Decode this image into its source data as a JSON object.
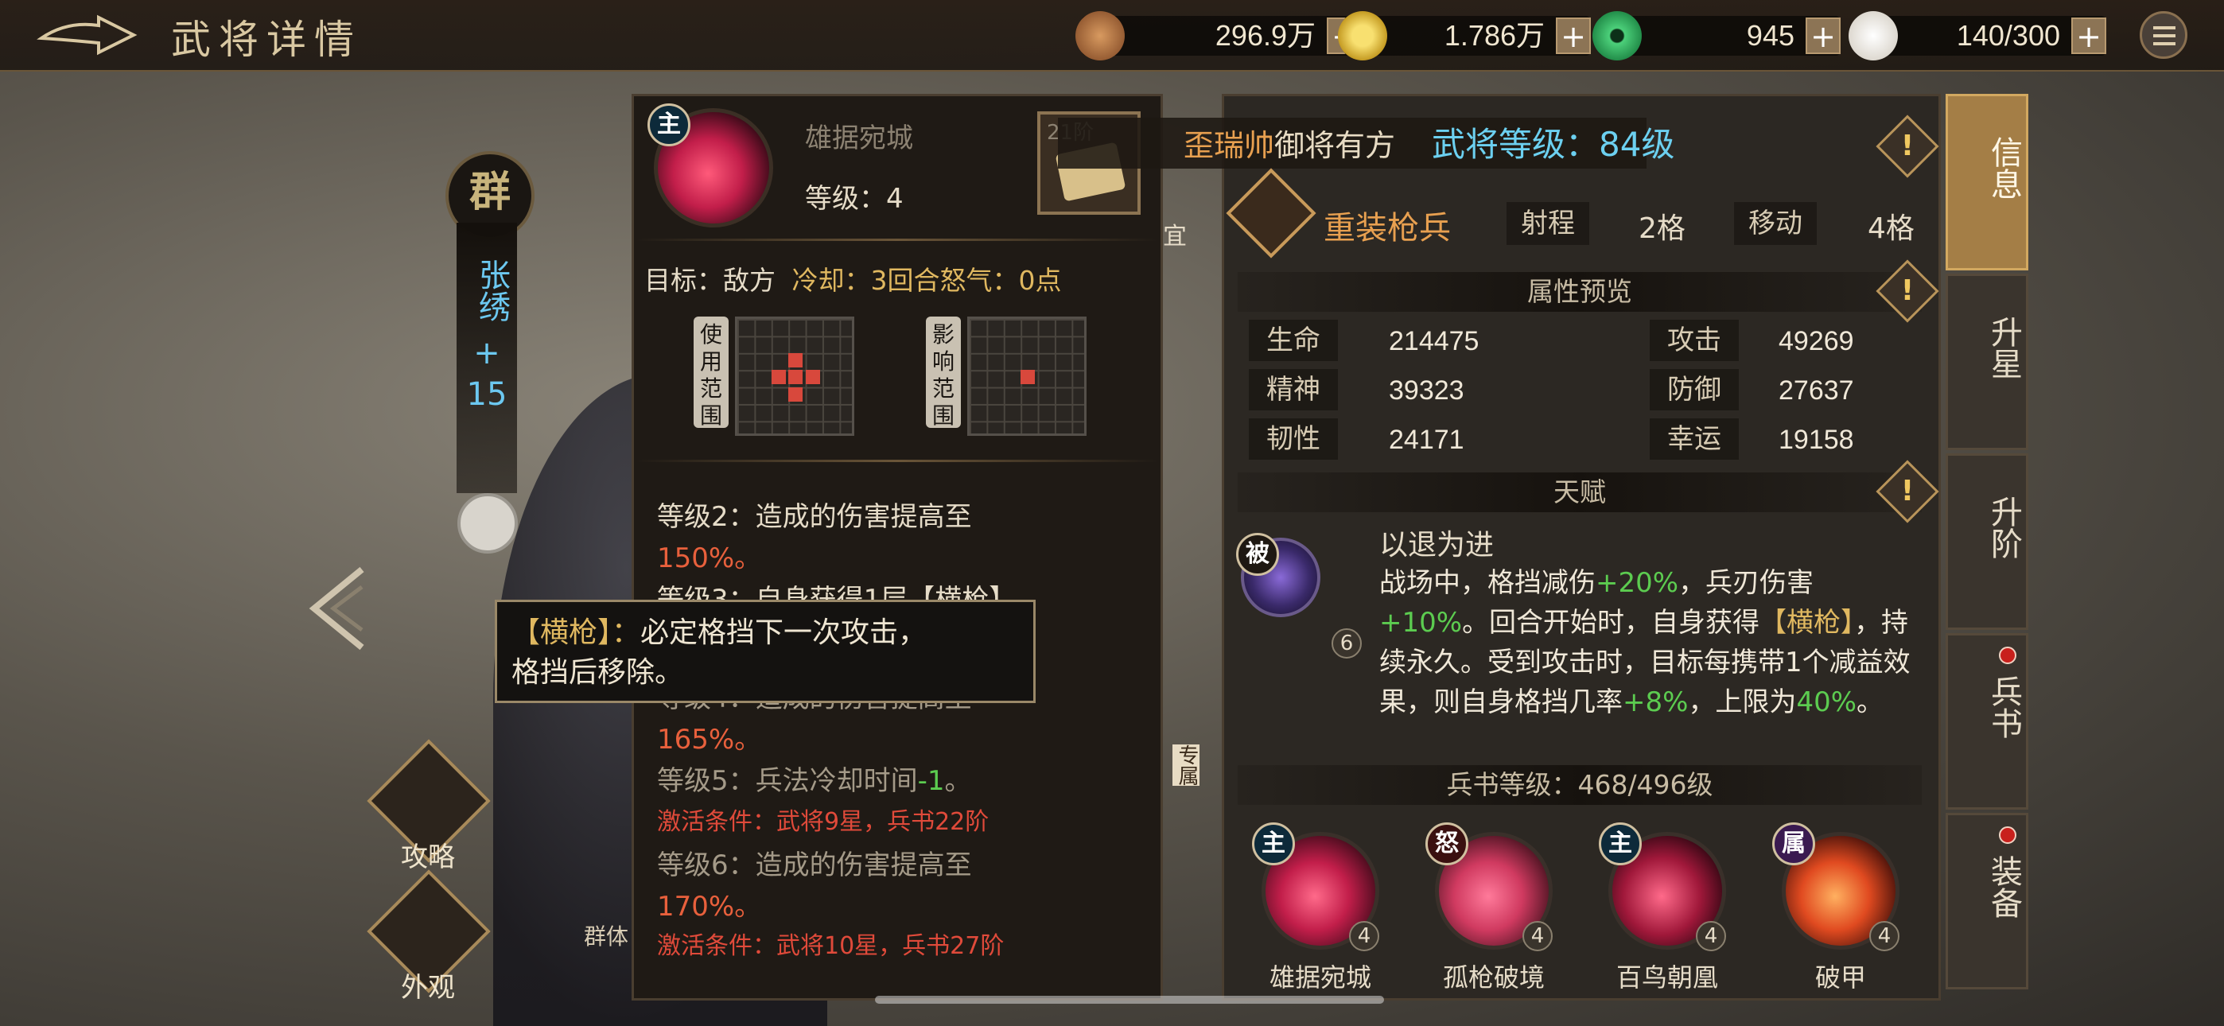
{
  "header": {
    "title": "武将详情"
  },
  "resources": [
    {
      "name": "copper-coins",
      "value": "296.9万",
      "color": "#b87848"
    },
    {
      "name": "gold-coin",
      "value": "1.786万",
      "color": "#e8c030"
    },
    {
      "name": "jade",
      "value": "945",
      "color": "#3cb46a"
    },
    {
      "name": "steamed-bun",
      "value": "140/300",
      "color": "#f0ece4"
    }
  ],
  "general": {
    "faction": "群",
    "name": "张绣",
    "plus": "+",
    "star": "15",
    "faction_bottom": "群体"
  },
  "side_buttons": {
    "guide": "攻略",
    "appearance": "外观"
  },
  "skill": {
    "badge": "主",
    "name": "雄据宛城",
    "level_label": "等级：4",
    "book_stage": "21阶",
    "target": "目标：敌方",
    "cooldown": "冷却：3回合",
    "rage": "怒气：0点",
    "use_range_label": "使用范围",
    "effect_range_label": "影响范围",
    "levels": [
      {
        "text": "等级2：造成的伤害提高至",
        "value": "150%。"
      },
      {
        "text": "等级3：自身获得1层【横枪】，"
      },
      {
        "text": "等级4：造成的伤害提高至",
        "value": "165%。"
      },
      {
        "text": "等级5：兵法冷却时间",
        "value": "-1",
        "tail": "。"
      },
      {
        "cond": "激活条件：武将9星，兵书22阶"
      },
      {
        "text": "等级6：造成的伤害提高至",
        "value": "170%。"
      },
      {
        "cond": "激活条件：武将10星，兵书27阶"
      }
    ]
  },
  "tooltip": {
    "keyword": "【横枪】：",
    "line1": "必定格挡下一次攻击，",
    "line2": "格挡后移除。"
  },
  "banner": {
    "user": "歪瑞帅",
    "text": "御将有方",
    "level_text": "武将等级：84级"
  },
  "info": {
    "troop_type": "重装枪兵",
    "range_label": "射程",
    "range_value": "2格",
    "move_label": "移动",
    "move_value": "4格",
    "attr_title": "属性预览",
    "stats": [
      {
        "label": "生命",
        "value": "214475"
      },
      {
        "label": "攻击",
        "value": "49269"
      },
      {
        "label": "精神",
        "value": "39323"
      },
      {
        "label": "防御",
        "value": "27637"
      },
      {
        "label": "韧性",
        "value": "24171"
      },
      {
        "label": "幸运",
        "value": "19158"
      }
    ],
    "talent_title": "天赋",
    "talent_badge": "被",
    "talent_level": "6",
    "talent_name": "以退为进",
    "talent_desc": {
      "a": "战场中，格挡减伤",
      "b": "+20%",
      "c": "，兵刃伤害",
      "d": "+10%",
      "e": "。回合开始时，自身获得",
      "f": "【横枪】",
      "g": "，持续永久。受到攻击时，目标每携带1个减益效果，则自身格挡几率",
      "h": "+8%",
      "i": "，上限为",
      "j": "40%",
      "k": "。"
    },
    "book_level": "兵书等级：468/496级",
    "skills": [
      {
        "badge": "主",
        "name": "雄据宛城",
        "level": "4"
      },
      {
        "badge": "怒",
        "name": "孤枪破境",
        "level": "4"
      },
      {
        "badge": "主",
        "name": "百鸟朝凰",
        "level": "4"
      },
      {
        "badge": "属",
        "name": "破甲",
        "level": "4"
      }
    ]
  },
  "tabs": [
    {
      "label": "信息",
      "active": true
    },
    {
      "label": "升星"
    },
    {
      "label": "升阶"
    },
    {
      "label": "兵书",
      "dot": true
    },
    {
      "label": "装备",
      "dot": true
    }
  ],
  "misc": {
    "exclusive": "专属",
    "partial_char": "宜"
  }
}
